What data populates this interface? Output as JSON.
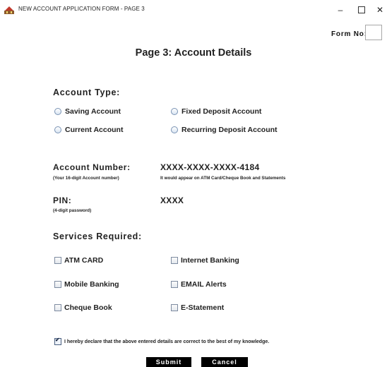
{
  "window": {
    "title": "NEW ACCOUNT APPLICATION FORM - PAGE 3",
    "minimize_glyph": "–",
    "close_glyph": "✕"
  },
  "form_no": {
    "label": "Form No:",
    "value": ""
  },
  "page_title": "Page 3: Account Details",
  "account_type": {
    "title": "Account Type:",
    "options": [
      "Saving Account",
      "Fixed Deposit Account",
      "Current Account",
      "Recurring Deposit Account"
    ]
  },
  "account_number": {
    "label": "Account Number:",
    "hint": "(Your 16-digit Account number)",
    "value": "XXXX-XXXX-XXXX-4184",
    "note": "It would appear on ATM Card/Cheque Book and Statements"
  },
  "pin": {
    "label": "PIN:",
    "hint": "(4-digit password)",
    "value": "XXXX"
  },
  "services": {
    "title": "Services Required:",
    "options": [
      "ATM CARD",
      "Internet Banking",
      "Mobile Banking",
      "EMAIL Alerts",
      "Cheque Book",
      "E-Statement"
    ]
  },
  "declaration": "I hereby declare that the above entered details are correct to the best of my knowledge.",
  "buttons": {
    "submit": "Submit",
    "cancel": "Cancel"
  },
  "colors": {
    "radio_border": "#7a93b4",
    "button_bg": "#000000"
  }
}
